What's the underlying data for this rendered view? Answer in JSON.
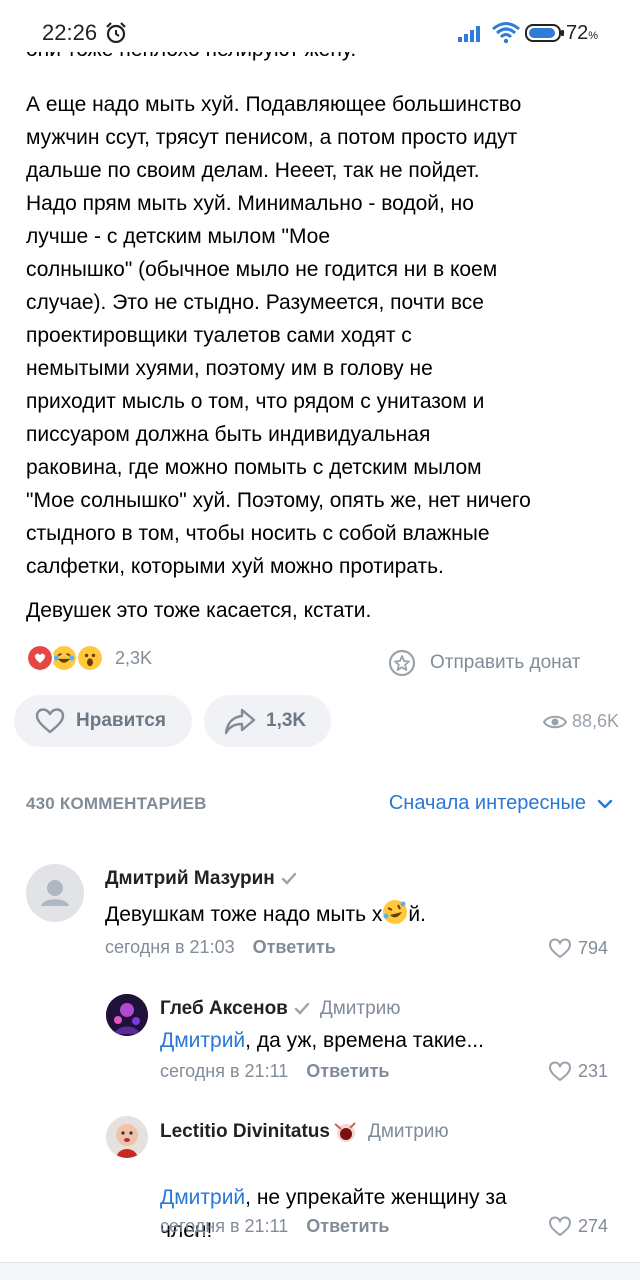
{
  "status_bar": {
    "time": "22:26",
    "battery": "72",
    "battery_unit": "%",
    "icons": [
      "alarm-icon",
      "signal-icon",
      "wifi-icon",
      "battery-icon"
    ]
  },
  "post": {
    "cut_line": "они тоже неплохо пелируют жену.",
    "paragraph": "А еще надо мыть хуй. Подавляющее большинство\nмужчин ссут, трясут пенисом, а потом просто идут\nдальше по своим делам. Нееет, так не пойдет.\nНадо прям мыть хуй. Минимально - водой, но\nлучше - с детским мылом \"Мое\nсолнышко\" (обычное мыло не годится ни в коем\nслучае). Это не стыдно. Разумеется, почти все\nпроектировщики туалетов сами ходят с\nнемытыми хуями, поэтому им в голову не\nприходит мысль о том, что рядом с унитазом и\nписсуаром должна быть индивидуальная\nраковина, где можно помыть с детским мылом\n\"Мое солнышко\" хуй. Поэтому, опять же, нет ничего\nстыдного в том, чтобы носить с собой влажные\nсалфетки, которыми хуй можно протирать.",
    "last_line": "Девушек это тоже касается, кстати.",
    "reactions": {
      "icons": [
        "heart-reaction-icon",
        "laughing-tears-reaction-icon",
        "shocked-reaction-icon"
      ],
      "count": "2,3K"
    },
    "donate_label": "Отправить донат",
    "like_label": "Нравится",
    "share_count": "1,3K",
    "views_count": "88,6K"
  },
  "comments_section": {
    "count_label": "430 КОММЕНТАРИЕВ",
    "sort_label": "Сначала интересные"
  },
  "comments": [
    {
      "author": "Дмитрий Мазурин",
      "text_before": "Девушкам тоже надо мыть х",
      "emoji": "rofl-emoji-icon",
      "text_after": "й.",
      "time": "сегодня в 21:03",
      "reply_label": "Ответить",
      "likes": "794"
    },
    {
      "author": "Глеб Аксенов",
      "reply_to": "Дмитрию",
      "mention": "Дмитрий",
      "text": ", да уж, времена такие...",
      "time": "сегодня в 21:11",
      "reply_label": "Ответить",
      "likes": "231"
    },
    {
      "author": "Lectitio Divinitatus",
      "reply_to": "Дмитрию",
      "mention": "Дмитрий",
      "text": ", не упрекайте женщину за\nчлен!",
      "time": "сегодня в 21:11",
      "reply_label": "Ответить",
      "likes": "274"
    }
  ],
  "colors": {
    "link": "#2a78d6",
    "secondary_text": "#818c99",
    "pill_background": "#f0f2f5",
    "heart": "#e64646"
  }
}
